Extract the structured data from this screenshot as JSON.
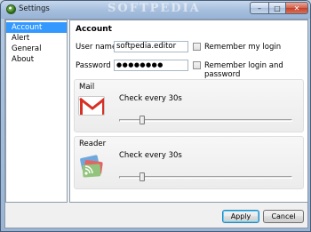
{
  "window": {
    "title": "Settings",
    "watermark": "SOFTPEDIA",
    "minimize_glyph": "–",
    "maximize_glyph": "□",
    "close_glyph": "✕"
  },
  "sidebar": {
    "items": [
      {
        "label": "Account",
        "selected": true
      },
      {
        "label": "Alert",
        "selected": false
      },
      {
        "label": "General",
        "selected": false
      },
      {
        "label": "About",
        "selected": false
      }
    ]
  },
  "account": {
    "title": "Account",
    "username_label": "User name",
    "username_value": "softpedia.editor",
    "password_label": "Password",
    "password_value": "●●●●●●●●",
    "remember_login_label": "Remember my login",
    "remember_login_checked": false,
    "remember_both_label": "Remember login and password",
    "remember_both_checked": false
  },
  "mail": {
    "title": "Mail",
    "icon": "gmail-icon",
    "interval_label": "Check every 30s",
    "slider_fraction": 0.12
  },
  "reader": {
    "title": "Reader",
    "icon": "google-reader-icon",
    "interval_label": "Check every 30s",
    "slider_fraction": 0.12
  },
  "buttons": {
    "apply": "Apply",
    "cancel": "Cancel"
  },
  "colors": {
    "selection": "#3399ff",
    "gmail_red": "#d93025",
    "close_red": "#c5402a"
  }
}
